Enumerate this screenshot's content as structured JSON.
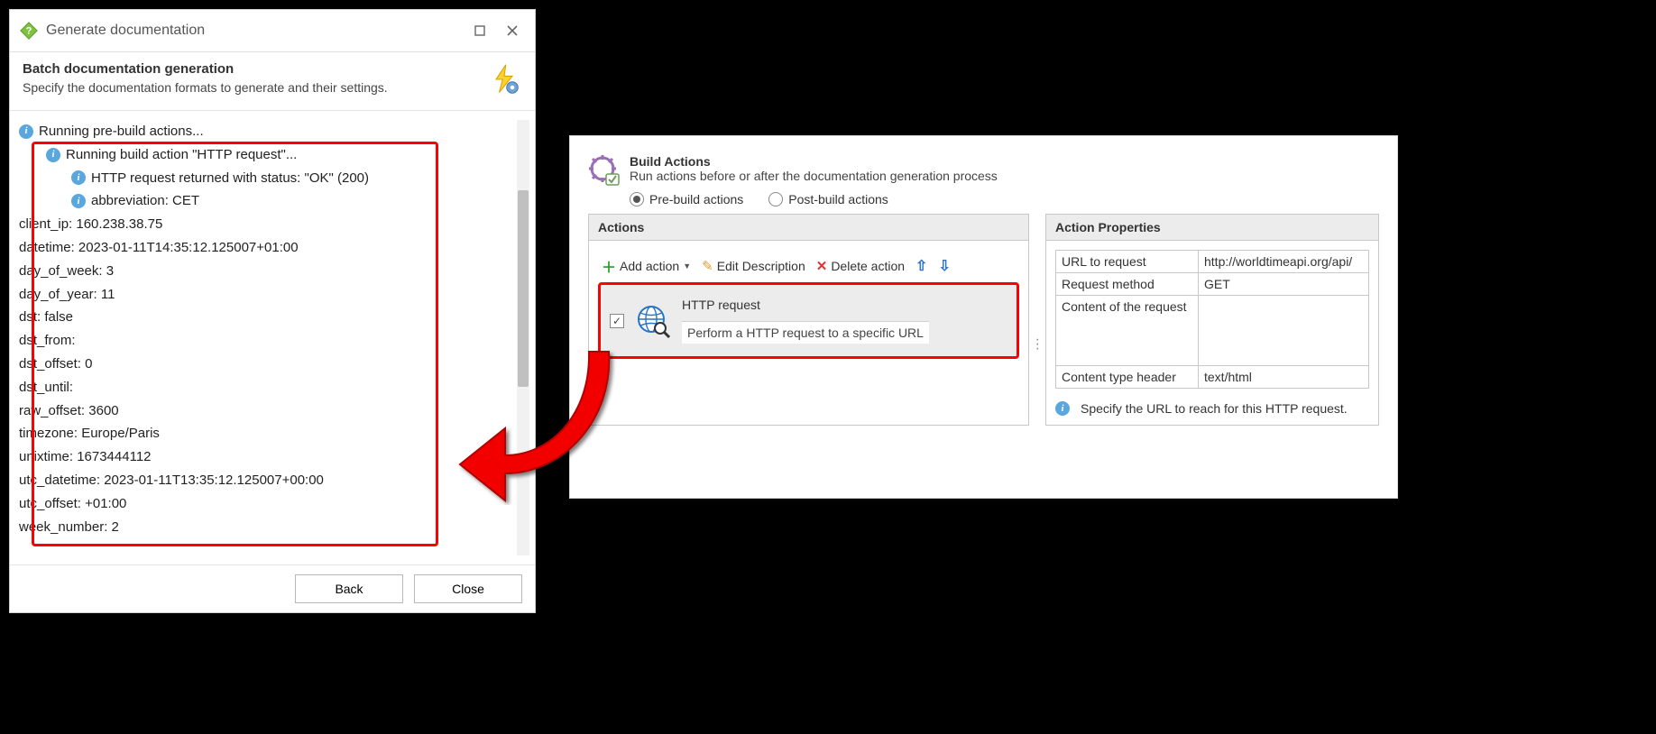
{
  "dialog": {
    "title": "Generate documentation",
    "header_title": "Batch documentation generation",
    "header_sub": "Specify the documentation formats to generate and their settings.",
    "log": {
      "l0": "Running pre-build actions...",
      "l1": "Running build action \"HTTP request\"...",
      "l2": "HTTP request returned with status: \"OK\" (200)",
      "l3": "abbreviation: CET",
      "l4": "client_ip: 160.238.38.75",
      "l5": "datetime: 2023-01-11T14:35:12.125007+01:00",
      "l6": "day_of_week: 3",
      "l7": "day_of_year: 11",
      "l8": "dst: false",
      "l9": "dst_from:",
      "l10": "dst_offset: 0",
      "l11": "dst_until:",
      "l12": "raw_offset: 3600",
      "l13": "timezone: Europe/Paris",
      "l14": "unixtime: 1673444112",
      "l15": "utc_datetime: 2023-01-11T13:35:12.125007+00:00",
      "l16": "utc_offset: +01:00",
      "l17": "week_number: 2"
    },
    "buttons": {
      "back": "Back",
      "close": "Close"
    }
  },
  "panel": {
    "title": "Build Actions",
    "sub": "Run actions before or after the documentation generation process",
    "radio_pre": "Pre-build actions",
    "radio_post": "Post-build actions",
    "actions_header": "Actions",
    "props_header": "Action Properties",
    "toolbar": {
      "add": "Add action",
      "edit": "Edit Description",
      "del": "Delete action"
    },
    "action_item": {
      "title": "HTTP request",
      "desc": "Perform a HTTP request to a specific URL"
    },
    "props": {
      "url_label": "URL to request",
      "url_value": "http://worldtimeapi.org/api/",
      "method_label": "Request method",
      "method_value": "GET",
      "content_label": "Content of the request",
      "content_value": "",
      "ctype_label": "Content type header",
      "ctype_value": "text/html"
    },
    "hint": "Specify the URL to reach for this HTTP request."
  }
}
